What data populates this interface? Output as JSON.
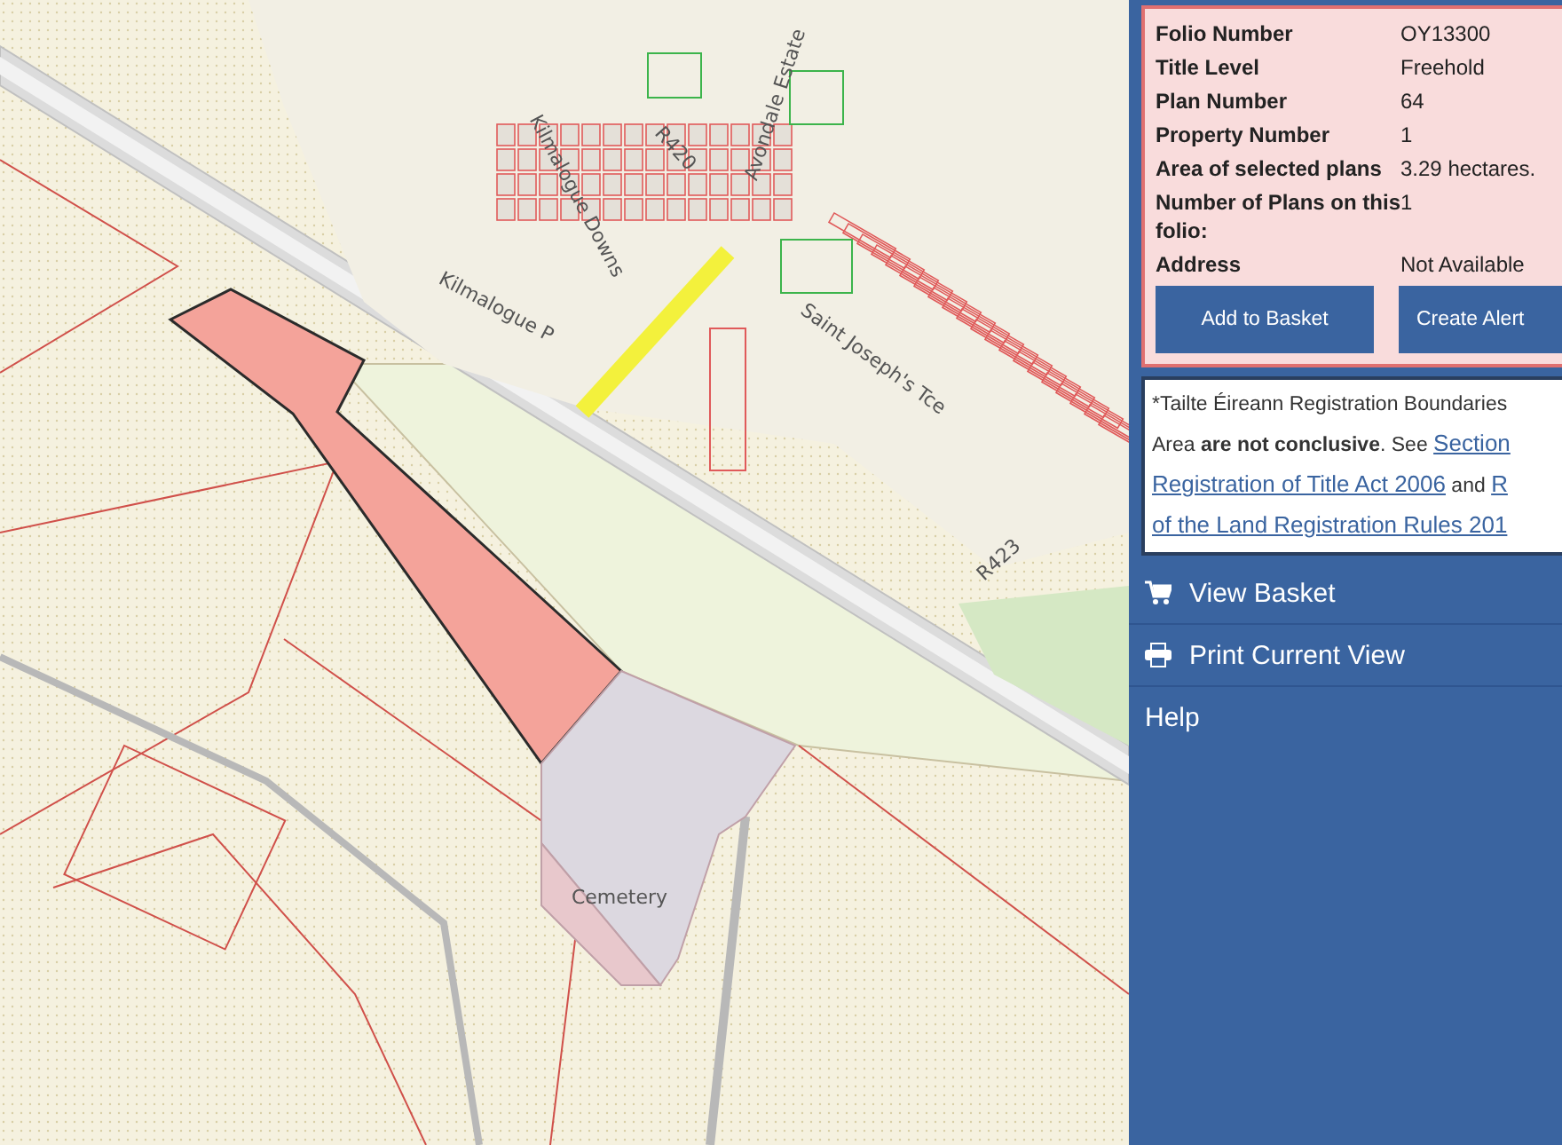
{
  "map": {
    "labels": [
      {
        "text": "Kilmalogue Downs"
      },
      {
        "text": "R420"
      },
      {
        "text": "Avondale Estate"
      },
      {
        "text": "Kilmalogue P"
      },
      {
        "text": "Saint Joseph's Tce"
      },
      {
        "text": "R423"
      },
      {
        "text": "Cemetery"
      }
    ]
  },
  "folio": {
    "rows": [
      {
        "label": "Folio Number",
        "value": "OY13300"
      },
      {
        "label": "Title Level",
        "value": "Freehold"
      },
      {
        "label": "Plan Number",
        "value": "64"
      },
      {
        "label": "Property Number",
        "value": "1"
      },
      {
        "label": "Area of selected plans",
        "value": "3.29 hectares."
      },
      {
        "label": "Number of Plans on this folio:",
        "value": "1"
      },
      {
        "label": "Address",
        "value": "Not Available"
      }
    ],
    "buttons": [
      "Add to Basket",
      "Create Alert"
    ]
  },
  "notice": {
    "lines": [
      [
        {
          "kind": "text",
          "text": "*Tailte Éireann Registration Boundaries"
        }
      ],
      [
        {
          "kind": "text",
          "text": "Area "
        },
        {
          "kind": "bold",
          "text": "are not conclusive"
        },
        {
          "kind": "text",
          "text": ". See "
        },
        {
          "kind": "link",
          "text": "Section"
        }
      ],
      [
        {
          "kind": "link",
          "text": "Registration of Title Act 2006"
        },
        {
          "kind": "text",
          "text": " and "
        },
        {
          "kind": "link",
          "text": "R"
        }
      ],
      [
        {
          "kind": "link",
          "text": "of the Land Registration Rules 201"
        }
      ]
    ]
  },
  "menu": [
    {
      "kind": "basket",
      "label": "View Basket"
    },
    {
      "kind": "print",
      "label": "Print Current View"
    },
    {
      "kind": "plain",
      "label": "Help"
    }
  ]
}
